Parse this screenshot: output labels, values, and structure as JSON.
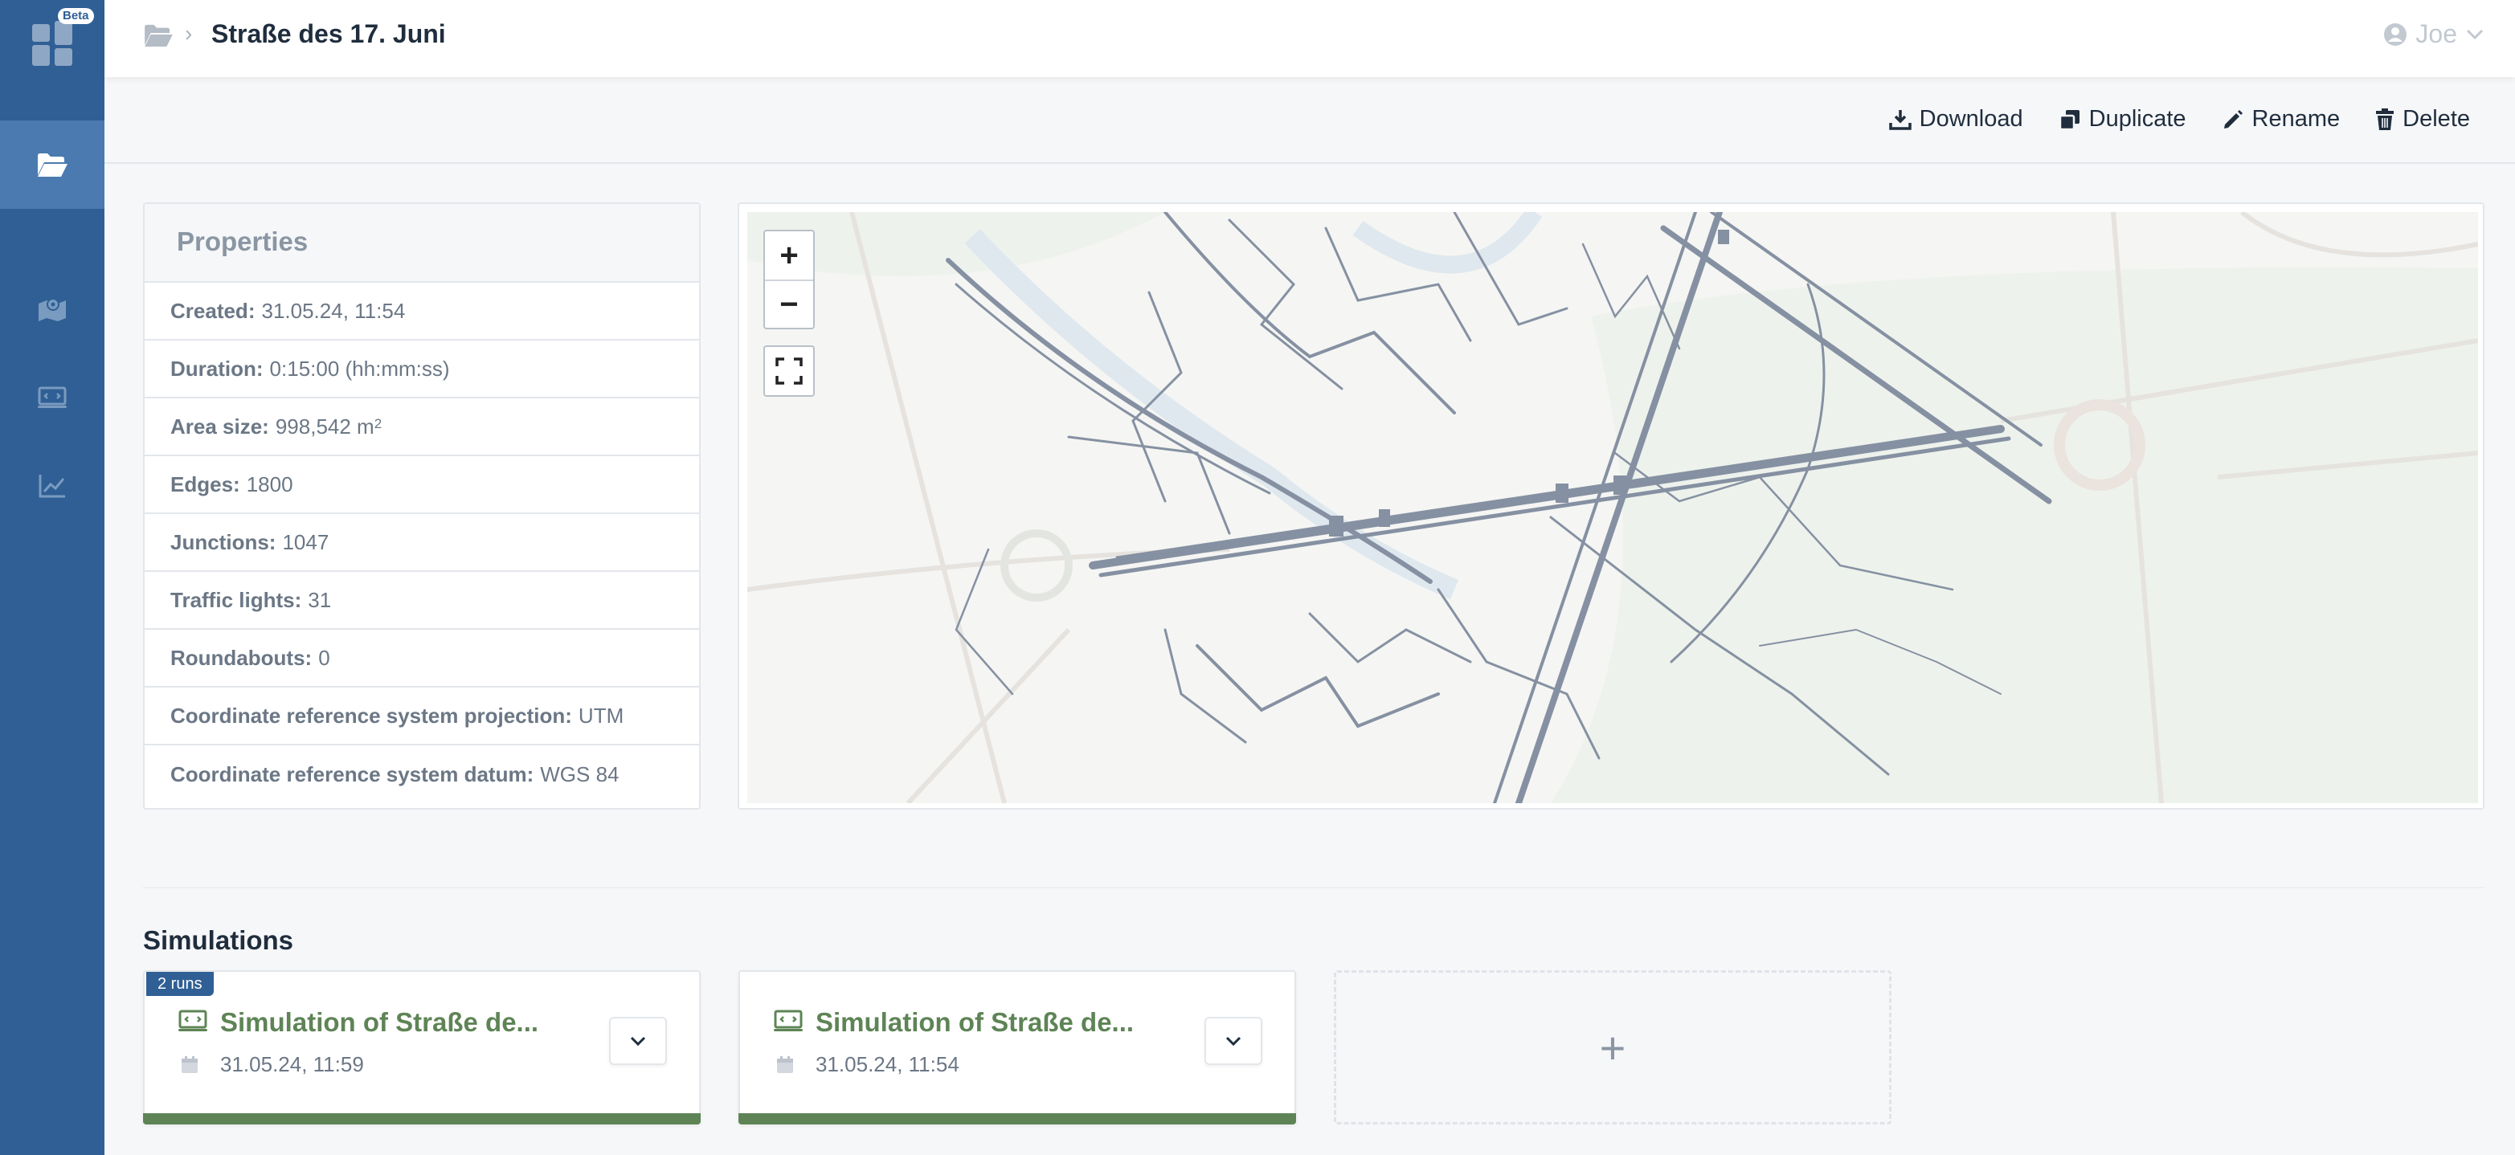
{
  "app": {
    "logo_badge": "Beta"
  },
  "sidebar": {
    "items": [
      {
        "name": "networks",
        "icon": "folder-open-icon",
        "active": true
      },
      {
        "name": "map",
        "icon": "map-marker-icon",
        "active": false
      },
      {
        "name": "simulations",
        "icon": "simulation-icon",
        "active": false
      },
      {
        "name": "analysis",
        "icon": "chart-line-icon",
        "active": false
      }
    ]
  },
  "header": {
    "breadcrumb_icon": "folder-open-icon",
    "title": "Straße des 17. Juni",
    "user": "Joe"
  },
  "toolbar": {
    "download": "Download",
    "duplicate": "Duplicate",
    "rename": "Rename",
    "delete": "Delete"
  },
  "properties": {
    "title": "Properties",
    "rows": [
      {
        "label": "Created:",
        "value": "31.05.24, 11:54"
      },
      {
        "label": "Duration:",
        "value": "0:15:00 (hh:mm:ss)"
      },
      {
        "label": "Area size:",
        "value": "998,542 m",
        "sup": "2"
      },
      {
        "label": "Edges:",
        "value": "1800"
      },
      {
        "label": "Junctions:",
        "value": "1047"
      },
      {
        "label": "Traffic lights:",
        "value": "31"
      },
      {
        "label": "Roundabouts:",
        "value": "0"
      },
      {
        "label": "Coordinate reference system projection:",
        "value": "UTM"
      },
      {
        "label": "Coordinate reference system datum:",
        "value": "WGS 84"
      }
    ]
  },
  "map": {
    "zoom_in": "+",
    "zoom_out": "−"
  },
  "simulations": {
    "title": "Simulations",
    "cards": [
      {
        "badge": "2 runs",
        "title": "Simulation of Straße de...",
        "date": "31.05.24, 11:59"
      },
      {
        "badge": "",
        "title": "Simulation of Straße de...",
        "date": "31.05.24, 11:54"
      }
    ],
    "add_label": "+"
  },
  "colors": {
    "sidebar": "#2f5f94",
    "accent_green": "#5e8456",
    "network": "#7e8a9a"
  }
}
